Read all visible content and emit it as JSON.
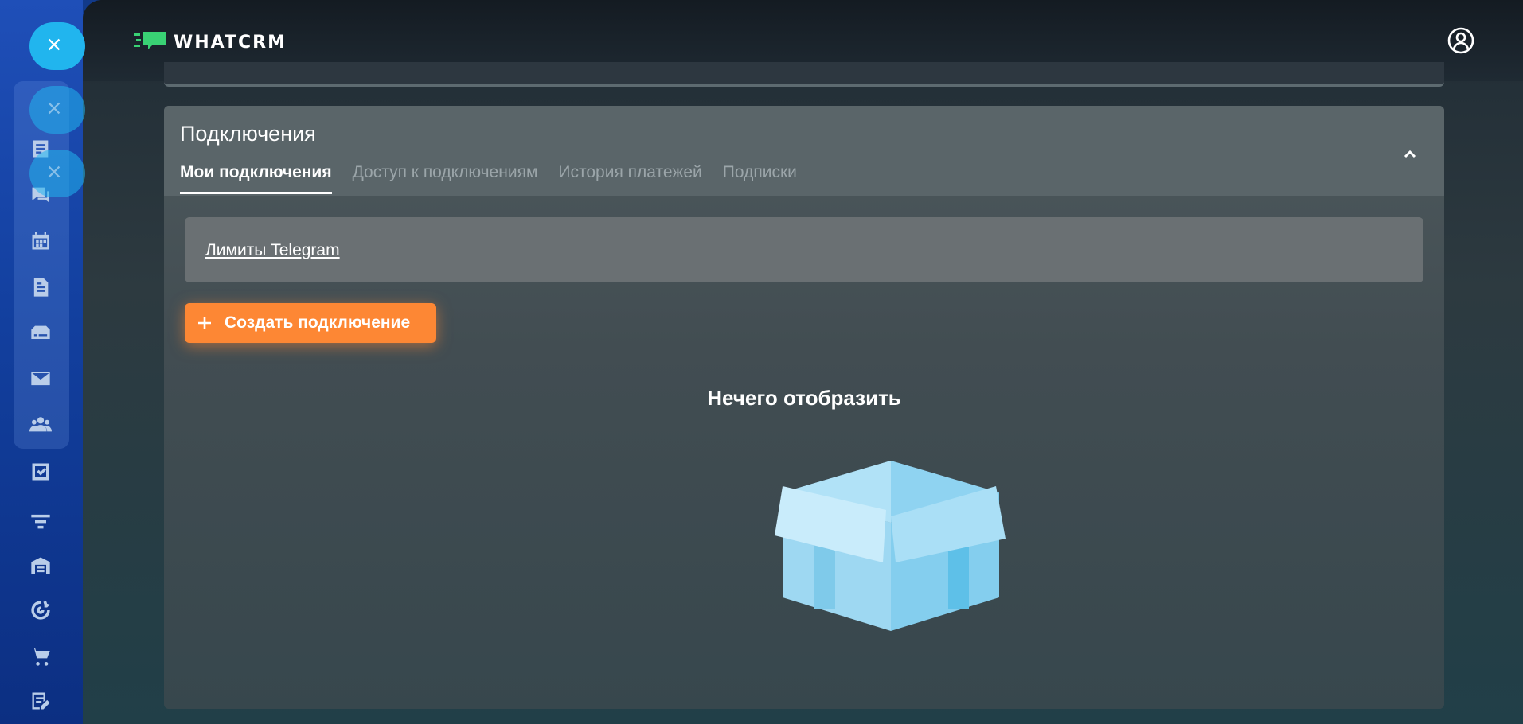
{
  "colors": {
    "accent_orange": "#fd8734",
    "sidebar_blue": "#1f4fb8",
    "pill_cyan": "#21b5ee",
    "brand_green": "#39d274"
  },
  "brand": {
    "name": "WHATCRM",
    "logo_icon": "chat-bubble-logo-icon"
  },
  "header": {
    "user_icon": "user-circle-icon"
  },
  "sidebar": {
    "close_pills": [
      "close-icon",
      "close-icon",
      "close-icon"
    ],
    "icons": [
      "list-icon",
      "chat-icon",
      "calendar-icon",
      "document-icon",
      "inbox-icon",
      "mail-icon",
      "users-icon",
      "checkbox-icon",
      "filter-icon",
      "warehouse-icon",
      "target-icon",
      "cart-icon",
      "edit-list-icon"
    ]
  },
  "card": {
    "title": "Подключения",
    "tabs": [
      {
        "label": "Мои подключения",
        "active": true
      },
      {
        "label": "Доступ к подключениям",
        "active": false
      },
      {
        "label": "История платежей",
        "active": false
      },
      {
        "label": "Подписки",
        "active": false
      }
    ],
    "limits_link": "Лимиты Telegram",
    "create_button": "Создать подключение",
    "empty_text": "Нечего отобразить"
  }
}
